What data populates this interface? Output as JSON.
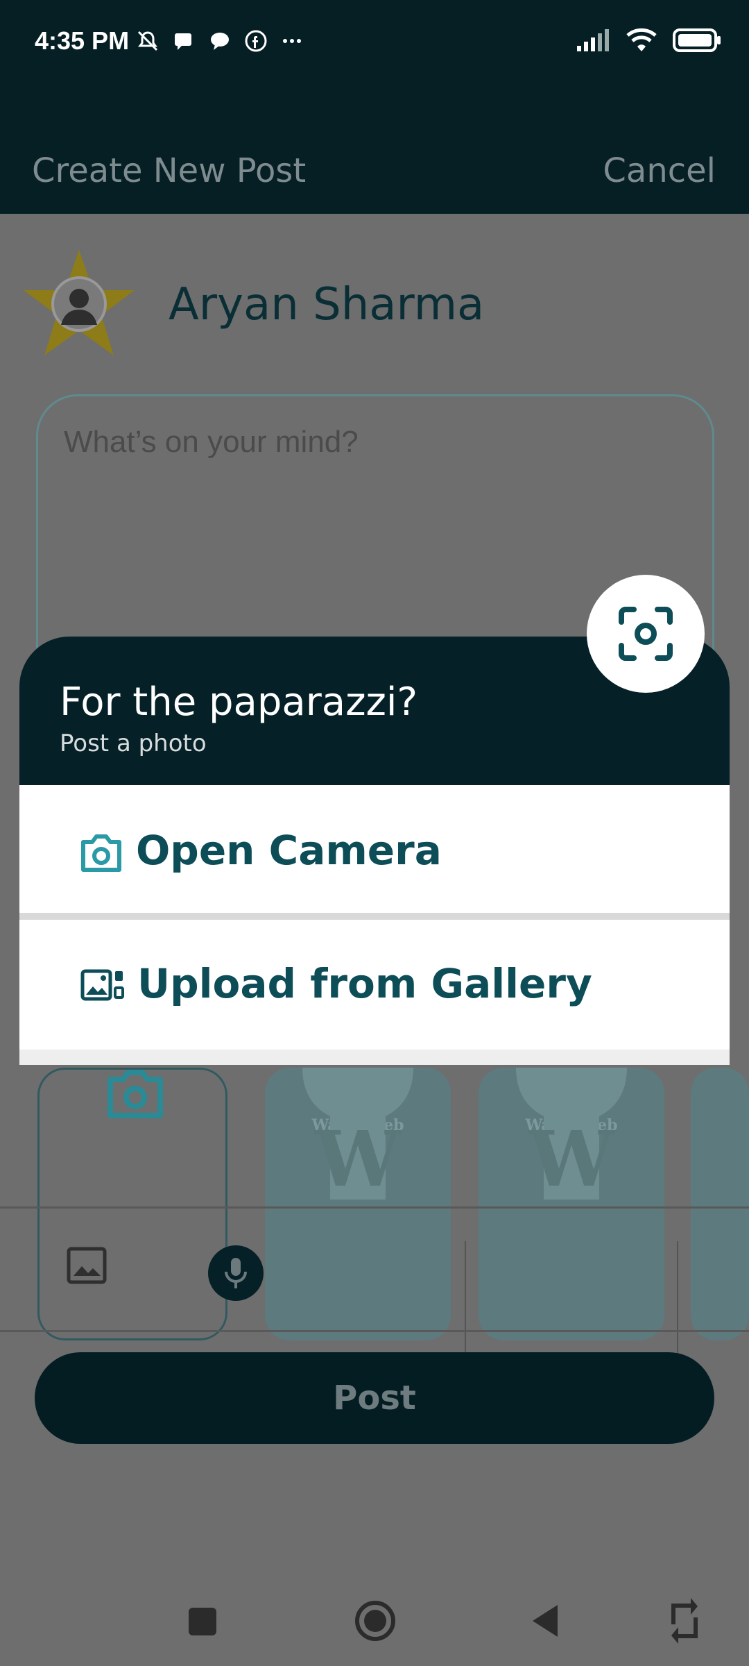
{
  "status_bar": {
    "time": "4:35 PM",
    "left_icons": [
      "muted-icon",
      "message-icon",
      "chat-icon",
      "facebook-icon",
      "more-dots-icon"
    ],
    "right_icons": [
      "signal-icon",
      "wifi-icon",
      "battery-icon"
    ]
  },
  "header": {
    "title": "Create New Post",
    "cancel_label": "Cancel"
  },
  "composer": {
    "user_name": "Aryan Sharma",
    "avatar_icon": "star-avatar-icon",
    "placeholder": "What’s on your mind?"
  },
  "media": {
    "thumb_label": "Walkofweb"
  },
  "toolbar": {
    "post_label": "Post"
  },
  "sheet": {
    "title": "For the paparazzi?",
    "subtitle": "Post a photo",
    "options": [
      {
        "label": "Open Camera",
        "icon": "camera-icon"
      },
      {
        "label": "Upload from Gallery",
        "icon": "gallery-icon"
      }
    ],
    "fab_icon": "scan-camera-icon"
  },
  "nav_bar": {
    "buttons": [
      "recents-square-icon",
      "home-circle-icon",
      "back-triangle-icon",
      "rotate-icon"
    ]
  },
  "colors": {
    "primary_dark": "#052027",
    "accent_teal": "#0d4d57",
    "icon_teal": "#2a9aa6"
  }
}
